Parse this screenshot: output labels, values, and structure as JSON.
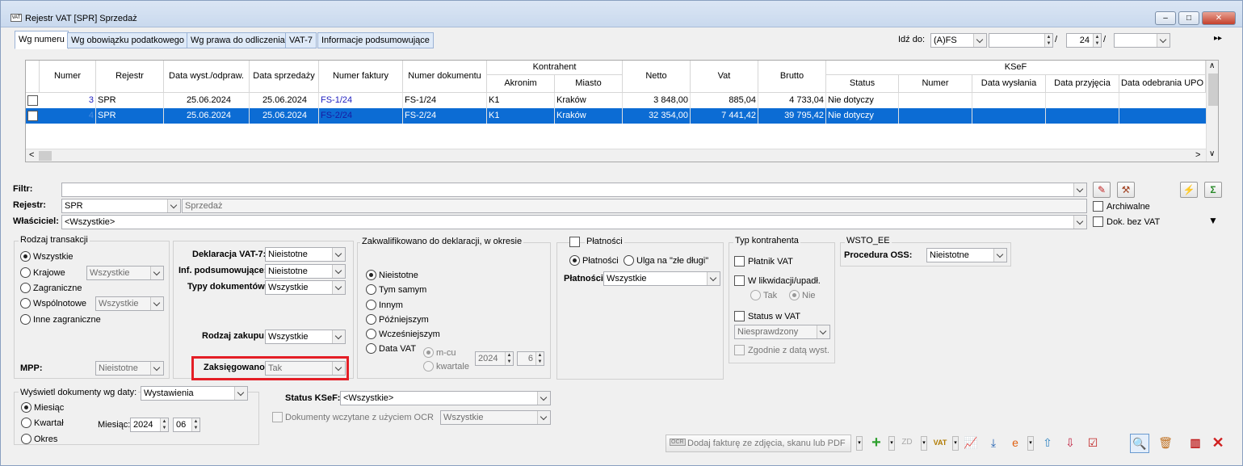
{
  "window": {
    "title": "Rejestr VAT  [SPR]  Sprzedaż",
    "icon_text": "VAT",
    "minimize": "–",
    "maximize": "□",
    "close": "✕"
  },
  "tabs": [
    "Wg numeru",
    "Wg obowiązku podatkowego",
    "Wg prawa do odliczenia",
    "VAT-7",
    "Informacje podsumowujące"
  ],
  "goto": {
    "label": "Idź do:",
    "doc_type": "(A)FS",
    "slash1": "/",
    "number": "24",
    "slash2": "/",
    "next": "▸▸"
  },
  "grid": {
    "headers": {
      "numer": "Numer",
      "rejestr": "Rejestr",
      "data_wyst": "Data wyst./odpraw.",
      "data_sprz": "Data sprzedaży",
      "numer_faktury": "Numer faktury",
      "numer_dokumentu": "Numer dokumentu",
      "kontrahent": "Kontrahent",
      "akronim": "Akronim",
      "miasto": "Miasto",
      "netto": "Netto",
      "vat": "Vat",
      "brutto": "Brutto",
      "ksef": "KSeF",
      "status": "Status",
      "ksef_numer": "Numer",
      "data_wyslania": "Data wysłania",
      "data_przyjecia": "Data przyjęcia",
      "data_odebrania": "Data odebrania UPO"
    },
    "rows": [
      {
        "numer": "3",
        "rejestr": "SPR",
        "data_wyst": "25.06.2024",
        "data_sprz": "25.06.2024",
        "numer_faktury": "FS-1/24",
        "numer_dokumentu": "FS-1/24",
        "akronim": "K1",
        "miasto": "Kraków",
        "netto": "3 848,00",
        "vat": "885,04",
        "brutto": "4 733,04",
        "status": "Nie dotyczy"
      },
      {
        "numer": "4",
        "rejestr": "SPR",
        "data_wyst": "25.06.2024",
        "data_sprz": "25.06.2024",
        "numer_faktury": "FS-2/24",
        "numer_dokumentu": "FS-2/24",
        "akronim": "K1",
        "miasto": "Kraków",
        "netto": "32 354,00",
        "vat": "7 441,42",
        "brutto": "39 795,42",
        "status": "Nie dotyczy"
      }
    ],
    "scroll_left": "<",
    "scroll_right": ">",
    "scroll_down": "∨",
    "scroll_up": "∧"
  },
  "filters": {
    "filtr_label": "Filtr:",
    "filtr_value": "",
    "rejestr_label": "Rejestr:",
    "rejestr_value": "SPR",
    "rejestr_name": "Sprzedaż",
    "wlasciciel_label": "Właściciel:",
    "wlasciciel_value": "<Wszystkie>",
    "archiwalne": "Archiwalne",
    "dok_bez_vat": "Dok. bez VAT"
  },
  "rodzaj_transakcji": {
    "title": "Rodzaj transakcji",
    "options": [
      "Wszystkie",
      "Krajowe",
      "Zagraniczne",
      "Wspólnotowe",
      "Inne zagraniczne"
    ],
    "krajowe_value": "Wszystkie",
    "wspolnotowe_value": "Wszystkie",
    "mpp_label": "MPP:",
    "mpp_value": "Nieistotne"
  },
  "deklaracje": {
    "vat7_label": "Deklaracja VAT-7:",
    "vat7_value": "Nieistotne",
    "inf_label": "Inf. podsumowujące:",
    "inf_value": "Nieistotne",
    "typy_label": "Typy dokumentów:",
    "typy_value": "Wszystkie",
    "rodzaj_zakupu_label": "Rodzaj zakupu:",
    "rodzaj_zakupu_value": "Wszystkie",
    "zaksiegowano_label": "Zaksięgowano:",
    "zaksiegowano_value": "Tak"
  },
  "zakwalifikowano": {
    "title": "Zakwalifikowano do deklaracji, w okresie",
    "options": [
      "Nieistotne",
      "Tym samym",
      "Innym",
      "Późniejszym",
      "Wcześniejszym",
      "Data VAT"
    ],
    "m_cu": "m-cu",
    "kwartale": "kwartale",
    "year": "2024",
    "month": "6"
  },
  "platnosci": {
    "title": "Płatności",
    "opt1": "Płatności",
    "opt2": "Ulga na \"złe długi\"",
    "label": "Płatności:",
    "value": "Wszystkie"
  },
  "typ_kontrahenta": {
    "title": "Typ kontrahenta",
    "platnik": "Płatnik VAT",
    "likwidacja": "W likwidacji/upadł.",
    "tak": "Tak",
    "nie": "Nie",
    "status_vat": "Status w VAT",
    "status_value": "Niesprawdzony",
    "zgodnie": "Zgodnie z datą wyst."
  },
  "wsto": {
    "title": "WSTO_EE",
    "label": "Procedura OSS:",
    "value": "Nieistotne"
  },
  "wyswietl": {
    "label": "Wyświetl dokumenty wg daty:",
    "value": "Wystawienia",
    "options": [
      "Miesiąc",
      "Kwartał",
      "Okres"
    ],
    "miesiac_label": "Miesiąc:",
    "year": "2024",
    "month": "06"
  },
  "ksef_status": {
    "label": "Status KSeF:",
    "value": "<Wszystkie>",
    "ocr_label": "Dokumenty wczytane z użyciem OCR",
    "ocr_value": "Wszystkie"
  },
  "toolbar": {
    "ocr_button": "Dodaj fakturę ze zdjęcia, skanu lub PDF",
    "ocr_icon_text": "OCR",
    "dropdown": "▾"
  }
}
